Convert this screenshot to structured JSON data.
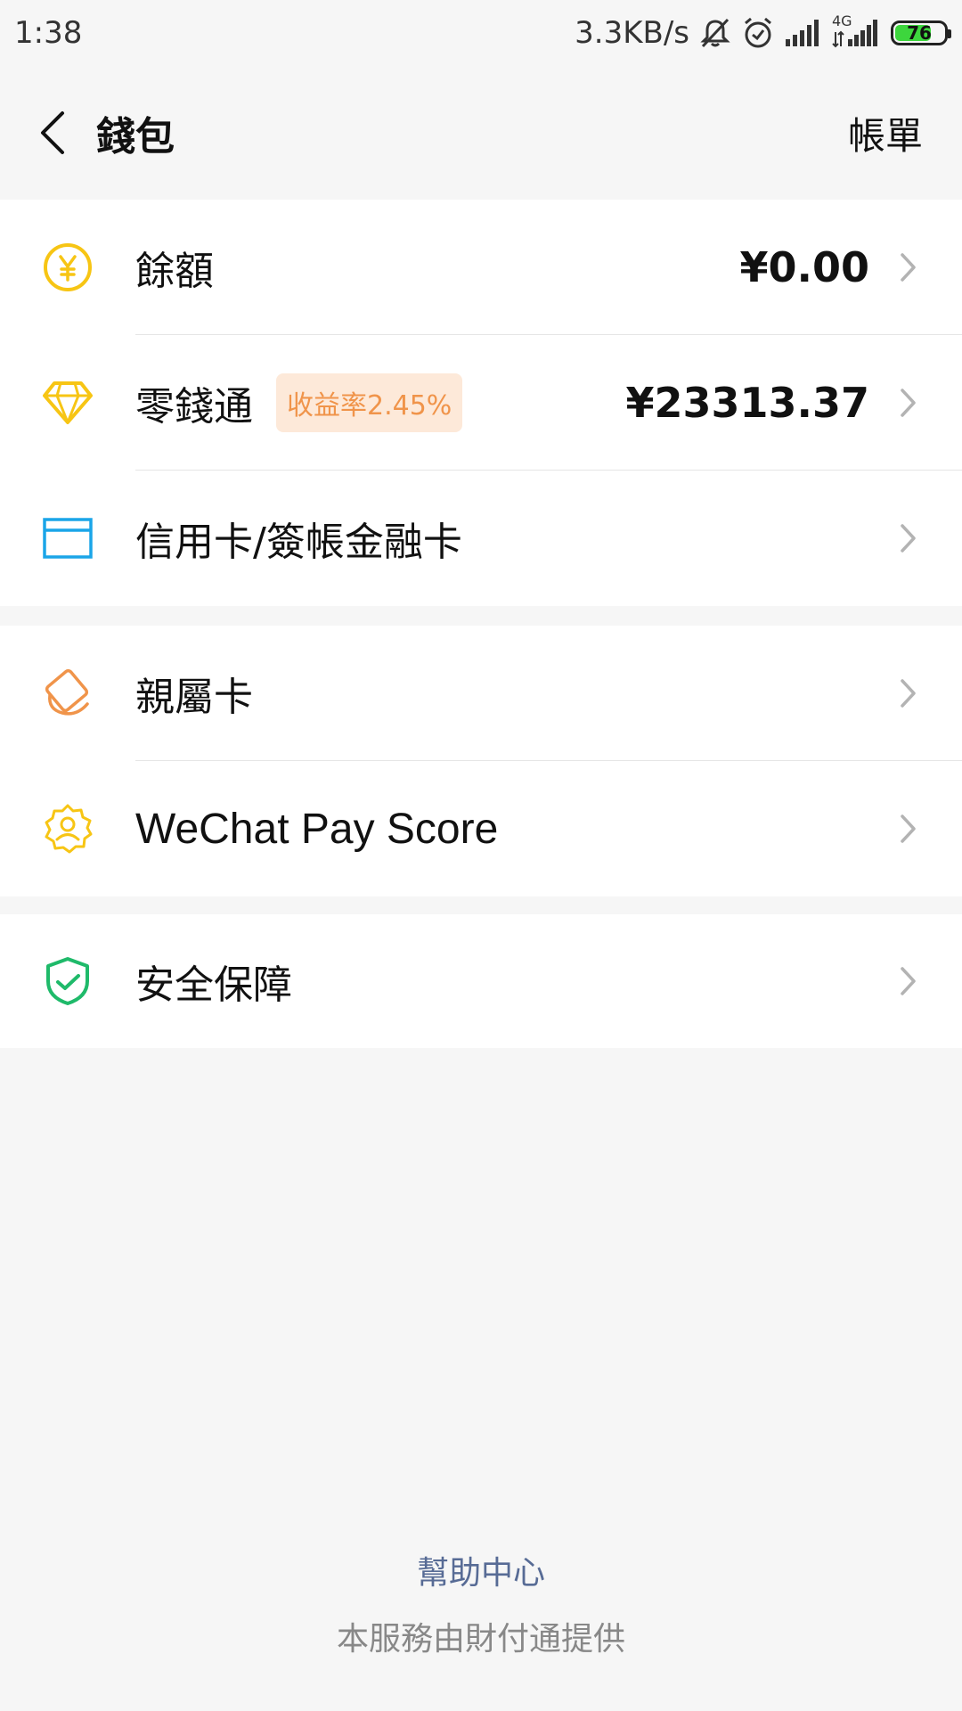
{
  "status_bar": {
    "time": "1:38",
    "network_speed": "3.3KB/s",
    "network_type": "4G",
    "battery_level": 76,
    "battery_text": "76",
    "icons": [
      "bell-off-icon",
      "alarm-icon",
      "signal-icon",
      "signal-4g-icon",
      "battery-icon"
    ]
  },
  "nav": {
    "title": "錢包",
    "bill_label": "帳單",
    "back_icon": "back-arrow-icon"
  },
  "groups": [
    {
      "items": [
        {
          "label": "餘額",
          "value": "¥0.00",
          "icon": "yuan-coin-icon",
          "icon_color": "#f7c514"
        },
        {
          "label": "零錢通",
          "badge": "收益率2.45%",
          "value": "¥23313.37",
          "icon": "diamond-icon",
          "icon_color": "#f7c514"
        },
        {
          "label": "信用卡/簽帳金融卡",
          "icon": "card-icon",
          "icon_color": "#1aa5e8"
        }
      ]
    },
    {
      "items": [
        {
          "label": "親屬卡",
          "icon": "family-card-icon",
          "icon_color": "#f0944a"
        },
        {
          "label": "WeChat Pay Score",
          "icon": "pay-score-icon",
          "icon_color": "#f7c514"
        }
      ]
    },
    {
      "items": [
        {
          "label": "安全保障",
          "icon": "shield-check-icon",
          "icon_color": "#1fba6a"
        }
      ]
    }
  ],
  "footer": {
    "help_center": "幫助中心",
    "provider": "本服務由財付通提供"
  },
  "colors": {
    "link": "#576b95",
    "badge_bg": "#fde9d9",
    "badge_text": "#f0944a",
    "battery_fill": "#3dd63d",
    "background": "#f6f6f6"
  }
}
